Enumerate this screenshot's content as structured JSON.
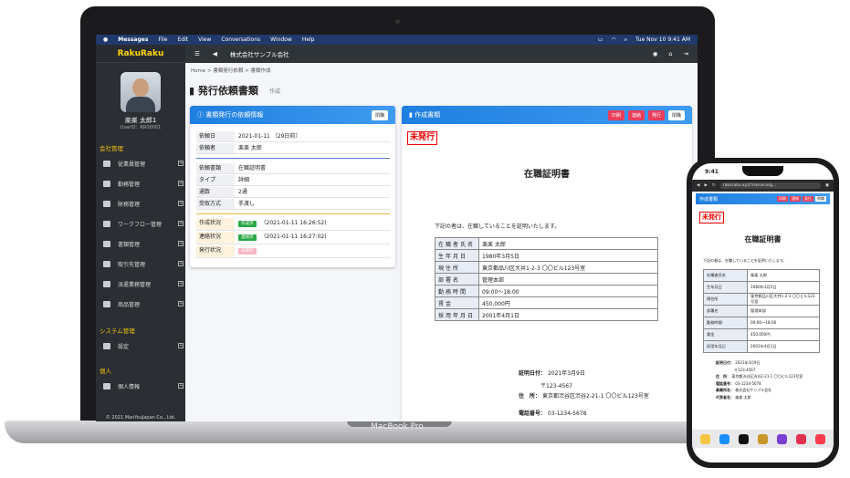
{
  "menubar": {
    "apple": "",
    "app": "Messages",
    "items": [
      "File",
      "Edit",
      "View",
      "Conversations",
      "Window",
      "Help"
    ],
    "datetime": "Tue Nov 10  9:41 AM"
  },
  "sidebar": {
    "logo": "RakuRaku",
    "user_name": "楽楽 太郎1",
    "user_id": "UserID：RR00001",
    "sections": [
      {
        "title": "会社管理",
        "items": [
          "従業員管理",
          "勤務管理",
          "財務管理",
          "ワークフロー管理",
          "書類管理",
          "取引先管理",
          "派遣業務管理",
          "商品管理"
        ]
      },
      {
        "title": "システム管理",
        "items": [
          "設定"
        ]
      },
      {
        "title": "個人",
        "items": [
          "個人情報"
        ]
      }
    ],
    "footer": "© 2021 ManYouJapan Co., Ltd."
  },
  "topbar": {
    "company": "株式会社サンプル会社"
  },
  "breadcrumb": [
    "Home",
    ">",
    "書類発行依頼",
    ">",
    "書類作成"
  ],
  "page": {
    "title": "発行依頼書類",
    "subtitle": "作成"
  },
  "left_card": {
    "title": "書類発行の依頼情報",
    "button": "閉職",
    "group1": [
      {
        "k": "依頼日",
        "v": "2021-01-11 （29日前）"
      },
      {
        "k": "依頼者",
        "v": "楽楽 太郎"
      }
    ],
    "group2": [
      {
        "k": "依頼書類",
        "v": "在職証明書"
      },
      {
        "k": "タイプ",
        "v": "詳細"
      },
      {
        "k": "通数",
        "v": "2通"
      },
      {
        "k": "受取方式",
        "v": "手渡し"
      }
    ],
    "group3": [
      {
        "k": "作成状況",
        "tag": "作成済",
        "v": "（2021-01-11 16:26:52)"
      },
      {
        "k": "連絡状況",
        "tag": "連絡済",
        "v": "（2021-01-11 16:27:02)"
      },
      {
        "k": "発行状況",
        "tag": "未発行",
        "v": ""
      }
    ]
  },
  "right_card": {
    "title": "作成書類",
    "buttons": [
      "印刷",
      "連絡",
      "発行",
      "閉職"
    ],
    "stamp": "未発行",
    "doc_title": "在職証明書",
    "intro": "下記の者は、在職していることを証明いたします。",
    "rows": [
      {
        "k": "在職者氏名",
        "v": "楽楽 太郎"
      },
      {
        "k": "生年月日",
        "v": "1980年3月5日"
      },
      {
        "k": "現住所",
        "v": "東京都品川区大井1-2-3 〇〇ビル123号室"
      },
      {
        "k": "部署名",
        "v": "管理本部"
      },
      {
        "k": "勤務時間",
        "v": "09:00～18:00"
      },
      {
        "k": "賃金",
        "v": "450,000円"
      },
      {
        "k": "採用年月日",
        "v": "2001年4月1日"
      }
    ],
    "footer": [
      {
        "k": "証明日付：",
        "v": "2021年3月9日"
      },
      {
        "k": "",
        "v": "〒123-4567"
      },
      {
        "k": "住　所：",
        "v": "東京都渋谷区渋谷2-21-1 〇〇ビル123号室"
      },
      {
        "k": "電話番号：",
        "v": "03-1234-5678"
      }
    ]
  },
  "macbook_label": "MacBook Pro",
  "phone": {
    "time": "9:41",
    "url": "rakuraku.xyz/!/service/g...",
    "title": "作成書類",
    "buttons": [
      "印刷",
      "連絡",
      "発行",
      "閉職"
    ],
    "stamp": "未発行",
    "doc_title": "在職証明書",
    "intro": "下記の者は、在職していることを証明いたします。",
    "rows": [
      {
        "k": "在職者氏名",
        "v": "楽楽 太郎"
      },
      {
        "k": "生年月日",
        "v": "1980年3月5日"
      },
      {
        "k": "現住所",
        "v": "東京都品川区大井1-2-3 〇〇ビル123号室"
      },
      {
        "k": "部署名",
        "v": "管理本部"
      },
      {
        "k": "勤務時間",
        "v": "09:00～18:00"
      },
      {
        "k": "賃金",
        "v": "450,000円"
      },
      {
        "k": "採用年月日",
        "v": "2001年4月1日"
      }
    ],
    "footer": [
      {
        "k": "証明日付：",
        "v": "2021年3月9日"
      },
      {
        "k": "",
        "v": "〒123-4567"
      },
      {
        "k": "住　所：",
        "v": "東京都渋谷区渋谷2-21-1 〇〇ビル123号室"
      },
      {
        "k": "電話番号：",
        "v": "03-1234-5678"
      },
      {
        "k": "事業所名：",
        "v": "株式会社サンプル会社"
      },
      {
        "k": "代表者名：",
        "v": "楽楽 太郎"
      }
    ]
  }
}
